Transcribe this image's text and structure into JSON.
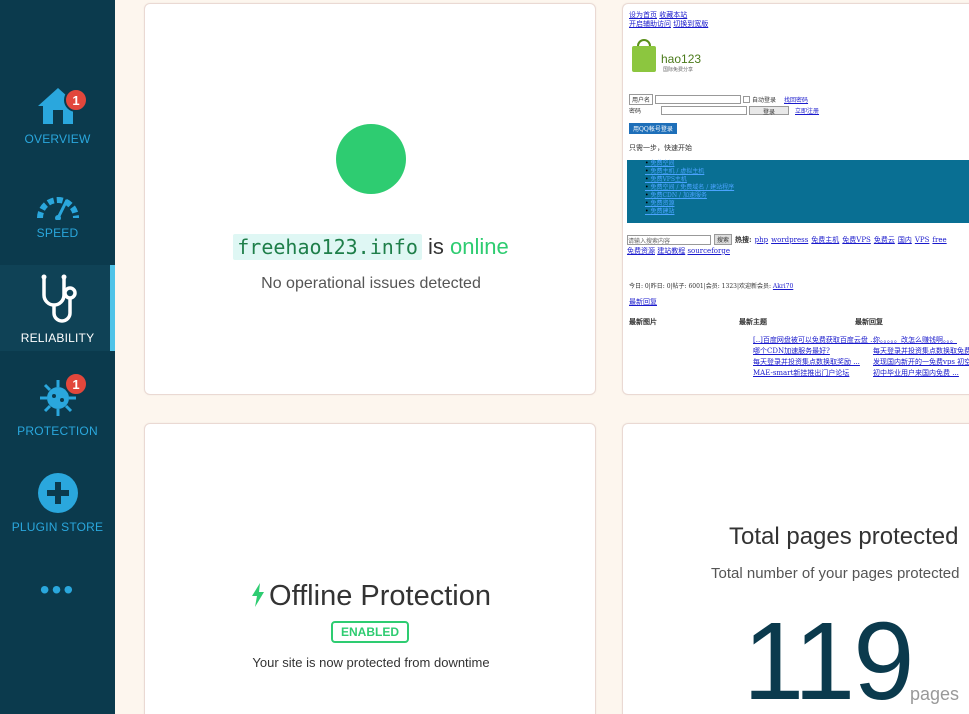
{
  "sidebar": {
    "items": [
      {
        "label": "OVERVIEW",
        "badge": "1",
        "icon": "home-icon"
      },
      {
        "label": "SPEED",
        "icon": "speedometer-icon"
      },
      {
        "label": "RELIABILITY",
        "icon": "stethoscope-icon"
      },
      {
        "label": "PROTECTION",
        "badge": "1",
        "icon": "virus-icon"
      },
      {
        "label": "PLUGIN STORE",
        "icon": "plus-circle-icon"
      }
    ],
    "more": "•••"
  },
  "status_card": {
    "domain": "freehao123.info",
    "is_word": "is",
    "status": "online",
    "sub": "No operational issues detected"
  },
  "preview": {
    "top_links": [
      "设为首页",
      "收藏本站"
    ],
    "top_links2": [
      "开启辅助访问",
      "切换到宽版"
    ],
    "logo_text": "hao123",
    "logo_sub": "国际免费分享",
    "user_label": "用户名",
    "password_label": "密码",
    "auto_login": "自动登录",
    "forgot": "找回密码",
    "login_btn": "登录",
    "register": "立即注册",
    "qq_btn": "用QQ帐号登录",
    "one_step": "只需一步，快速开始",
    "nav_items": [
      "免费空间",
      "免费主机 / 虚拟主机",
      "免费VPS主机",
      "免费空间 / 免费域名 / 建站程序",
      "免费CDN / 加速服务",
      "免费资源",
      "免费建站"
    ],
    "search_placeholder": "请输入搜索内容",
    "search_btn": "搜索",
    "hot_label": "热搜:",
    "hot_words": [
      "php",
      "wordpress",
      "免费主机",
      "免费VPS",
      "免费云",
      "国内",
      "VPS",
      "free"
    ],
    "forum_links": [
      "免费资源",
      "建站教程",
      "sourceforge"
    ],
    "stats": "今日: 0|昨日: 0|帖子: 6001|会员: 1323|欢迎新会员: ",
    "new_member": "Akri70",
    "latest_reply": "最新回复",
    "col_heads": [
      "最新图片",
      "最新主题",
      "最新回复"
    ],
    "col2_items": [
      "[..]百度网盘被可以免费获取百度云盘 ...",
      "哪个CDN加速服务最好?",
      "每天登录并投资集点数换取奖励 ...",
      "MAE-smart新挂推出门户论坛"
    ],
    "col3_items": [
      "你。。。。。改怎么赚钱啊。。。",
      "每天登录并投资集点数换取免费用 ...",
      "发现国内新开的一免费vps 初空间 ...",
      "初中毕业用户来国内免费 ..."
    ]
  },
  "offline_card": {
    "title": "Offline Protection",
    "badge": "ENABLED",
    "sub": "Your site is now protected from downtime"
  },
  "pages_card": {
    "title": "Total pages protected",
    "sub": "Total number of your pages protected",
    "count": "119",
    "unit": "pages"
  },
  "colors": {
    "sidebar_bg": "#0b3a4d",
    "accent_blue": "#2aa7dd",
    "online_green": "#2ecc71",
    "badge_red": "#e2473c"
  }
}
